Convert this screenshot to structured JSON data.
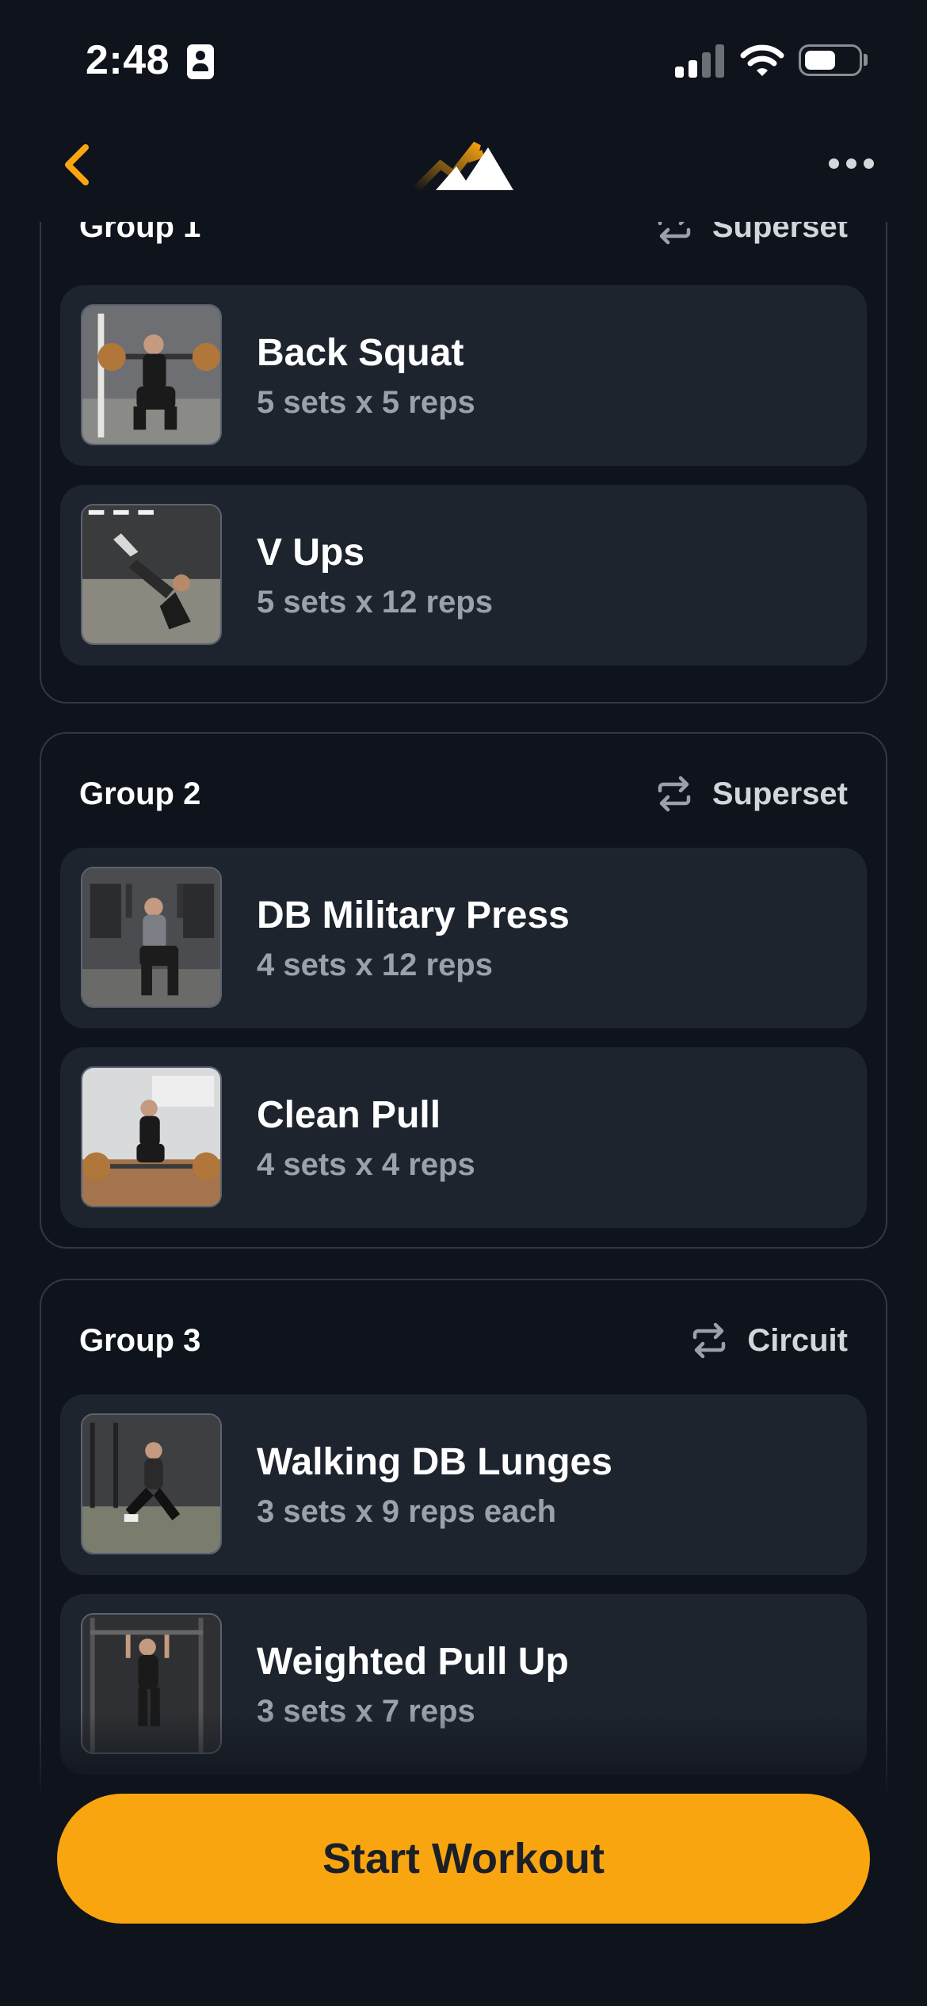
{
  "status_bar": {
    "time": "2:48",
    "icons": [
      "id-card-icon",
      "signal-icon",
      "wifi-icon",
      "battery-icon"
    ]
  },
  "nav": {
    "back_icon": "chevron-left-icon",
    "logo_icon": "mountain-logo-icon",
    "more_icon": "more-horizontal-icon"
  },
  "colors": {
    "background": "#0f131b",
    "card": "#1e242e",
    "group_border": "#323844",
    "accent": "#f9a510",
    "secondary_text": "#9ba1ab"
  },
  "groups": [
    {
      "title": "Group 1",
      "type": "Superset",
      "type_icon": "repeat-icon",
      "exercises": [
        {
          "name": "Back Squat",
          "detail": "5 sets x 5 reps"
        },
        {
          "name": "V Ups",
          "detail": "5 sets x 12 reps"
        }
      ]
    },
    {
      "title": "Group 2",
      "type": "Superset",
      "type_icon": "repeat-icon",
      "exercises": [
        {
          "name": "DB Military Press",
          "detail": "4 sets x 12 reps"
        },
        {
          "name": "Clean Pull",
          "detail": "4 sets x 4 reps"
        }
      ]
    },
    {
      "title": "Group 3",
      "type": "Circuit",
      "type_icon": "repeat-icon",
      "exercises": [
        {
          "name": "Walking DB Lunges",
          "detail": "3 sets x 9 reps each"
        },
        {
          "name": "Weighted Pull Up",
          "detail": "3 sets x 7 reps"
        }
      ]
    }
  ],
  "start_button_label": "Start Workout"
}
